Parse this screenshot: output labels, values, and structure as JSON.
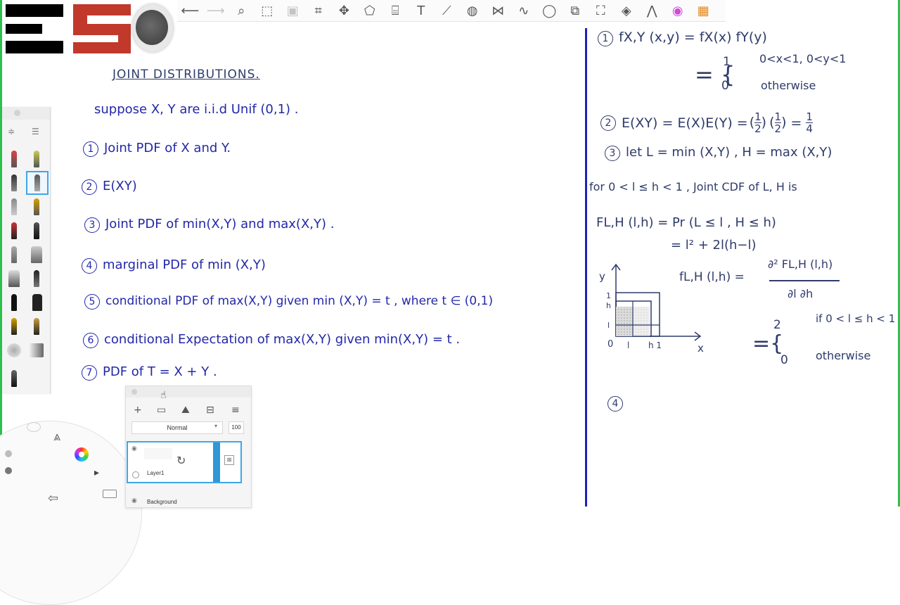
{
  "toolbar": {
    "tools": [
      "undo",
      "redo",
      "magnifier",
      "selection",
      "crop",
      "transform",
      "distort",
      "perspective",
      "ruler",
      "symmetry",
      "text",
      "fill",
      "perspective-guide",
      "french-curve",
      "stroke",
      "ellipse",
      "shape",
      "image-import",
      "layers",
      "brush-library",
      "color-wheel",
      "settings-grid"
    ]
  },
  "left_notes": {
    "title": "JOINT DISTRIBUTIONS.",
    "intro": "suppose X, Y are i.i.d Unif (0,1) .",
    "items": [
      {
        "n": "1",
        "text": "Joint PDF of X and Y."
      },
      {
        "n": "2",
        "text": "E(XY)"
      },
      {
        "n": "3",
        "text": "Joint PDF of min(X,Y) and max(X,Y) ."
      },
      {
        "n": "4",
        "text": "marginal PDF of min (X,Y)"
      },
      {
        "n": "5",
        "text": "conditional PDF of max(X,Y) given min (X,Y) = t , where t ∈ (0,1)"
      },
      {
        "n": "6",
        "text": "conditional Expectation of max(X,Y) given min(X,Y) = t ."
      },
      {
        "n": "7",
        "text": "PDF of T = X + Y ."
      }
    ]
  },
  "right_notes": {
    "s1_num": "1",
    "s1_line1": "fX,Y (x,y) = fX(x) fY(y)",
    "s1_case1_val": "1",
    "s1_case1_cond": "0<x<1, 0<y<1",
    "s1_case2_val": "0",
    "s1_case2_cond": "otherwise",
    "s2_num": "2",
    "s2_left": "E(XY) = E(X)E(Y) =",
    "s2_f1n": "1",
    "s2_f1d": "2",
    "s2_f2n": "1",
    "s2_f2d": "2",
    "s2_eq": "=",
    "s2_rn": "1",
    "s2_rd": "4",
    "s3_num": "3",
    "s3_line": "let  L = min (X,Y) , H = max (X,Y)",
    "s3_for": "for 0 < l ≤ h < 1 ,  Joint CDF of L, H is",
    "s3_cdf": "FL,H (l,h) = Pr (L ≤ l , H ≤ h)",
    "s3_cdf2": "= l² + 2l(h−l)",
    "s3_pdf_left": "fL,H (l,h) =",
    "s3_pdf_num": "∂² FL,H (l,h)",
    "s3_pdf_den": "∂l ∂h",
    "s3_case1_val": "2",
    "s3_case1_cond": "if 0 < l ≤ h < 1",
    "s3_case2_val": "0",
    "s3_case2_cond": "otherwise",
    "s4_num": "4",
    "sketch": {
      "y_label": "y",
      "x_label": "x",
      "origin": "0",
      "tick_l": "l",
      "tick_h1": "h 1",
      "tick_ly": "l",
      "tick_hy": "h",
      "tick_1y": "1"
    }
  },
  "layers_panel": {
    "blend_mode": "Normal",
    "opacity": "100",
    "layer_name": "Layer1",
    "background_name": "Background"
  }
}
